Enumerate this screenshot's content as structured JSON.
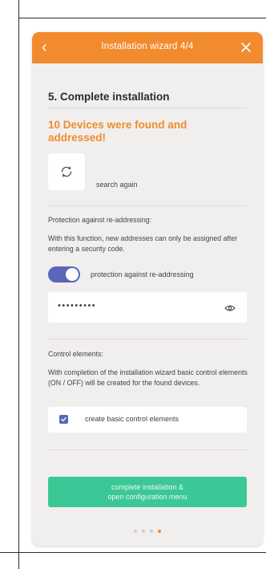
{
  "header": {
    "back_glyph": "‹",
    "title": "Installation wizard 4/4",
    "close_icon": "close-icon"
  },
  "step": {
    "title": "5. Complete installation",
    "found_message": "10 Devices were  found and addressed!",
    "search_again_label": "search again",
    "refresh_icon": "refresh-icon"
  },
  "protection": {
    "heading": "Protection against re-addressing:",
    "description": "With this function, new addresses can only be assigned after entering a security code.",
    "toggle_label": "protection against re-addressing",
    "toggle_on": true,
    "password_mask": "•••••••••",
    "eye_icon": "eye-icon"
  },
  "control": {
    "heading": "Control elements:",
    "description": "With completion of the installation wizard basic control elements (ON / OFF) will be created for the found devices.",
    "checkbox_label": "create basic control elements",
    "checkbox_checked": true
  },
  "actions": {
    "primary_line1": "complete installation &",
    "primary_line2": "open configuration menu"
  },
  "pager": {
    "total": 4,
    "active": 4
  },
  "colors": {
    "accent": "#f28b2e",
    "toggle": "#5a66b8",
    "primary_button": "#3cc896",
    "background": "#f1efee"
  }
}
